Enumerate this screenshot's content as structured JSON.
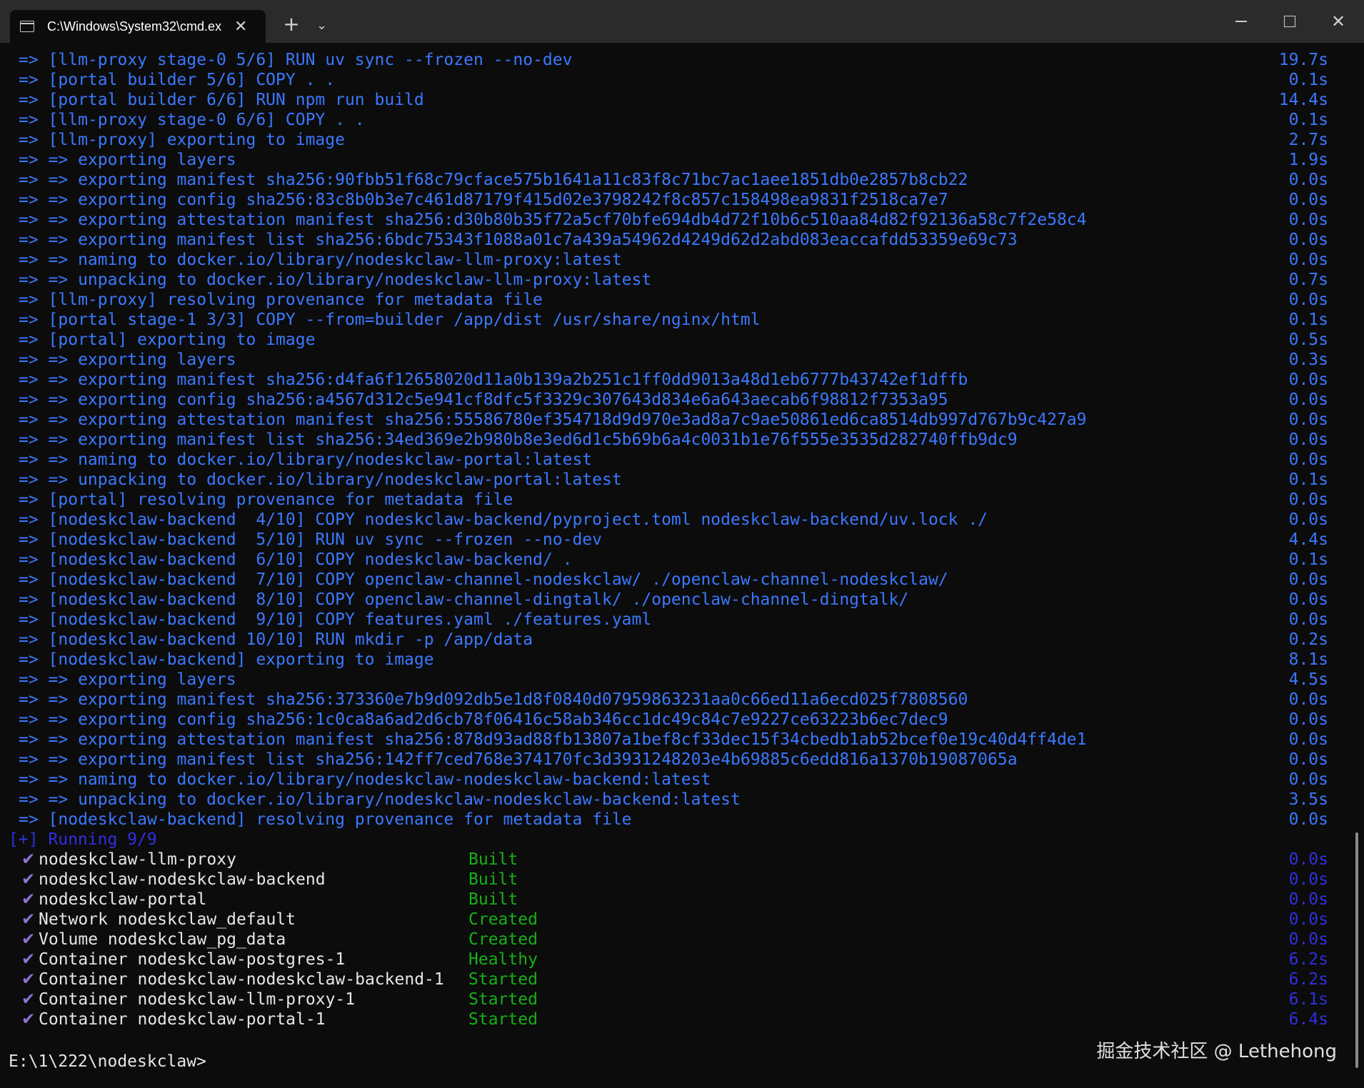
{
  "window": {
    "tab_title": "C:\\Windows\\System32\\cmd.ex",
    "tab_close": "✕",
    "new_tab": "+",
    "dropdown": "⌄",
    "close_glyph": "✕"
  },
  "build_lines": [
    {
      "text": "=> [llm-proxy stage-0 5/6] RUN uv sync --frozen --no-dev",
      "time": "19.7s"
    },
    {
      "text": "=> [portal builder 5/6] COPY . .",
      "time": "0.1s"
    },
    {
      "text": "=> [portal builder 6/6] RUN npm run build",
      "time": "14.4s"
    },
    {
      "text": "=> [llm-proxy stage-0 6/6] COPY . .",
      "time": "0.1s"
    },
    {
      "text": "=> [llm-proxy] exporting to image",
      "time": "2.7s"
    },
    {
      "text": "=> => exporting layers",
      "time": "1.9s"
    },
    {
      "text": "=> => exporting manifest sha256:90fbb51f68c79cface575b1641a11c83f8c71bc7ac1aee1851db0e2857b8cb22",
      "time": "0.0s"
    },
    {
      "text": "=> => exporting config sha256:83c8b0b3e7c461d87179f415d02e3798242f8c857c158498ea9831f2518ca7e7",
      "time": "0.0s"
    },
    {
      "text": "=> => exporting attestation manifest sha256:d30b80b35f72a5cf70bfe694db4d72f10b6c510aa84d82f92136a58c7f2e58c4",
      "time": "0.0s"
    },
    {
      "text": "=> => exporting manifest list sha256:6bdc75343f1088a01c7a439a54962d4249d62d2abd083eaccafdd53359e69c73",
      "time": "0.0s"
    },
    {
      "text": "=> => naming to docker.io/library/nodeskclaw-llm-proxy:latest",
      "time": "0.0s"
    },
    {
      "text": "=> => unpacking to docker.io/library/nodeskclaw-llm-proxy:latest",
      "time": "0.7s"
    },
    {
      "text": "=> [llm-proxy] resolving provenance for metadata file",
      "time": "0.0s"
    },
    {
      "text": "=> [portal stage-1 3/3] COPY --from=builder /app/dist /usr/share/nginx/html",
      "time": "0.1s"
    },
    {
      "text": "=> [portal] exporting to image",
      "time": "0.5s"
    },
    {
      "text": "=> => exporting layers",
      "time": "0.3s"
    },
    {
      "text": "=> => exporting manifest sha256:d4fa6f12658020d11a0b139a2b251c1ff0dd9013a48d1eb6777b43742ef1dffb",
      "time": "0.0s"
    },
    {
      "text": "=> => exporting config sha256:a4567d312c5e941cf8dfc5f3329c307643d834e6a643aecab6f98812f7353a95",
      "time": "0.0s"
    },
    {
      "text": "=> => exporting attestation manifest sha256:55586780ef354718d9d970e3ad8a7c9ae50861ed6ca8514db997d767b9c427a9",
      "time": "0.0s"
    },
    {
      "text": "=> => exporting manifest list sha256:34ed369e2b980b8e3ed6d1c5b69b6a4c0031b1e76f555e3535d282740ffb9dc9",
      "time": "0.0s"
    },
    {
      "text": "=> => naming to docker.io/library/nodeskclaw-portal:latest",
      "time": "0.0s"
    },
    {
      "text": "=> => unpacking to docker.io/library/nodeskclaw-portal:latest",
      "time": "0.1s"
    },
    {
      "text": "=> [portal] resolving provenance for metadata file",
      "time": "0.0s"
    },
    {
      "text": "=> [nodeskclaw-backend  4/10] COPY nodeskclaw-backend/pyproject.toml nodeskclaw-backend/uv.lock ./",
      "time": "0.0s"
    },
    {
      "text": "=> [nodeskclaw-backend  5/10] RUN uv sync --frozen --no-dev",
      "time": "4.4s"
    },
    {
      "text": "=> [nodeskclaw-backend  6/10] COPY nodeskclaw-backend/ .",
      "time": "0.1s"
    },
    {
      "text": "=> [nodeskclaw-backend  7/10] COPY openclaw-channel-nodeskclaw/ ./openclaw-channel-nodeskclaw/",
      "time": "0.0s"
    },
    {
      "text": "=> [nodeskclaw-backend  8/10] COPY openclaw-channel-dingtalk/ ./openclaw-channel-dingtalk/",
      "time": "0.0s"
    },
    {
      "text": "=> [nodeskclaw-backend  9/10] COPY features.yaml ./features.yaml",
      "time": "0.0s"
    },
    {
      "text": "=> [nodeskclaw-backend 10/10] RUN mkdir -p /app/data",
      "time": "0.2s"
    },
    {
      "text": "=> [nodeskclaw-backend] exporting to image",
      "time": "8.1s"
    },
    {
      "text": "=> => exporting layers",
      "time": "4.5s"
    },
    {
      "text": "=> => exporting manifest sha256:373360e7b9d092db5e1d8f0840d07959863231aa0c66ed11a6ecd025f7808560",
      "time": "0.0s"
    },
    {
      "text": "=> => exporting config sha256:1c0ca8a6ad2d6cb78f06416c58ab346cc1dc49c84c7e9227ce63223b6ec7dec9",
      "time": "0.0s"
    },
    {
      "text": "=> => exporting attestation manifest sha256:878d93ad88fb13807a1bef8cf33dec15f34cbedb1ab52bcef0e19c40d4ff4de1",
      "time": "0.0s"
    },
    {
      "text": "=> => exporting manifest list sha256:142ff7ced768e374170fc3d3931248203e4b69885c6edd816a1370b19087065a",
      "time": "0.0s"
    },
    {
      "text": "=> => naming to docker.io/library/nodeskclaw-nodeskclaw-backend:latest",
      "time": "0.0s"
    },
    {
      "text": "=> => unpacking to docker.io/library/nodeskclaw-nodeskclaw-backend:latest",
      "time": "3.5s"
    },
    {
      "text": "=> [nodeskclaw-backend] resolving provenance for metadata file",
      "time": "0.0s"
    }
  ],
  "running_line": "[+] Running 9/9",
  "services": [
    {
      "name": "nodeskclaw-llm-proxy",
      "status": "Built",
      "time": "0.0s"
    },
    {
      "name": "nodeskclaw-nodeskclaw-backend",
      "status": "Built",
      "time": "0.0s"
    },
    {
      "name": "nodeskclaw-portal",
      "status": "Built",
      "time": "0.0s"
    },
    {
      "name": "Network nodeskclaw_default",
      "status": "Created",
      "time": "0.0s"
    },
    {
      "name": "Volume nodeskclaw_pg_data",
      "status": "Created",
      "time": "0.0s"
    },
    {
      "name": "Container nodeskclaw-postgres-1",
      "status": "Healthy",
      "time": "6.2s"
    },
    {
      "name": "Container nodeskclaw-nodeskclaw-backend-1",
      "status": "Started",
      "time": "6.2s"
    },
    {
      "name": "Container nodeskclaw-llm-proxy-1",
      "status": "Started",
      "time": "6.1s"
    },
    {
      "name": "Container nodeskclaw-portal-1",
      "status": "Started",
      "time": "6.4s"
    }
  ],
  "check_glyph": "✔",
  "prompt": "E:\\1\\222\\nodeskclaw>",
  "watermark": "掘金技术社区 @ Lethehong",
  "icons": {
    "tab": "cmd-icon",
    "close": "close-icon",
    "new_tab": "plus-icon",
    "dropdown": "chevron-down-icon"
  }
}
